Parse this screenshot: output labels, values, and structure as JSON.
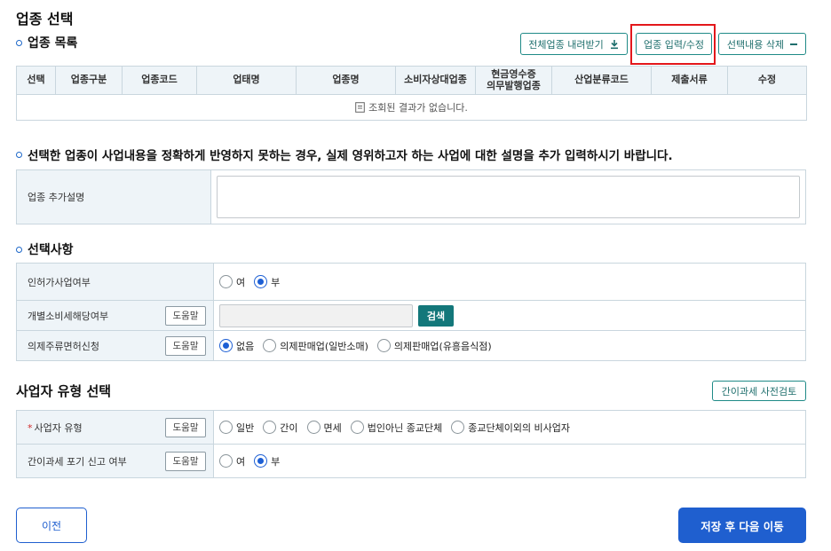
{
  "page_title": "업종 선택",
  "industry_list": {
    "title": "업종 목록",
    "buttons": {
      "download_all": "전체업종 내려받기",
      "input_edit": "업종 입력/수정",
      "delete_selected": "선택내용 삭제"
    },
    "columns": [
      "선택",
      "업종구분",
      "업종코드",
      "업태명",
      "업종명",
      "소비자상대업종",
      "현금영수증",
      "의무발행업종",
      "산업분류코드",
      "제출서류",
      "수정"
    ],
    "empty_message": "조회된 결과가 없습니다."
  },
  "notice": "선택한 업종이 사업내용을 정확하게 반영하지 못하는 경우, 실제 영위하고자 하는 사업에 대한 설명을 추가 입력하시기 바랍니다.",
  "additional": {
    "label": "업종 추가설명",
    "value": ""
  },
  "options_section": {
    "title": "선택사항",
    "license": {
      "label": "인허가사업여부",
      "opt_yes": "여",
      "opt_no": "부"
    },
    "excise": {
      "label": "개별소비세해당여부",
      "help": "도움말",
      "value": "",
      "search": "검색"
    },
    "liquor": {
      "label": "의제주류면허신청",
      "help": "도움말",
      "opt_none": "없음",
      "opt_retail": "의제판매업(일반소매)",
      "opt_bar": "의제판매업(유흥음식점)"
    }
  },
  "business_type": {
    "title": "사업자 유형 선택",
    "precheck": "간이과세 사전검토",
    "type_row": {
      "required": "*",
      "label": "사업자 유형",
      "help": "도움말",
      "opt_general": "일반",
      "opt_simple": "간이",
      "opt_exempt": "면세",
      "opt_nonprofit_religious": "법인아닌 종교단체",
      "opt_nonbusiness": "종교단체이외의 비사업자"
    },
    "waiver_row": {
      "label": "간이과세 포기 신고 여부",
      "help": "도움말",
      "opt_yes": "여",
      "opt_no": "부"
    }
  },
  "footer": {
    "prev": "이전",
    "next": "저장 후 다음 이동"
  },
  "colors": {
    "accent": "#1f5fcf",
    "teal": "#13777a",
    "highlight": "#e3171b"
  }
}
